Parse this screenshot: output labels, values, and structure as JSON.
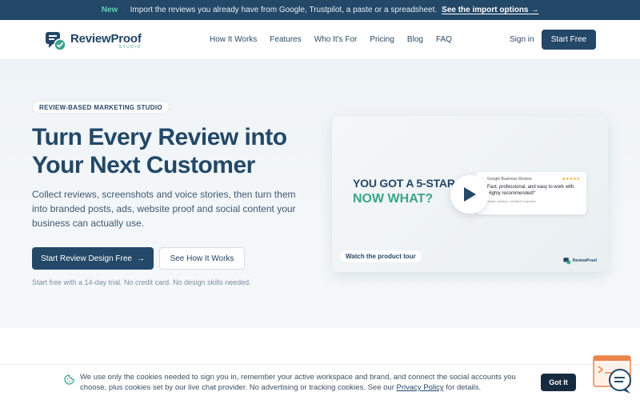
{
  "announcement": {
    "new_label": "New",
    "separator": "·",
    "text": "Import the reviews you already have from Google, Trustpilot, a paste or a spreadsheet.",
    "link": "See the import options",
    "link_arrow": "→"
  },
  "brand": {
    "name": "ReviewProof",
    "sub": "STUDIO"
  },
  "nav": {
    "items": [
      {
        "label": "How It Works"
      },
      {
        "label": "Features"
      },
      {
        "label": "Who It's For"
      },
      {
        "label": "Pricing"
      },
      {
        "label": "Blog"
      },
      {
        "label": "FAQ"
      }
    ],
    "signin": "Sign in",
    "start_free": "Start Free"
  },
  "hero": {
    "badge": "REVIEW-BASED MARKETING STUDIO",
    "headline": "Turn Every Review into Your Next Customer",
    "lede": "Collect reviews, screenshots and voice stories, then turn them into branded posts, ads, website proof and social content your business can actually use.",
    "cta_primary": "Start Review Design Free",
    "cta_primary_arrow": "→",
    "cta_secondary": "See How It Works",
    "fineprint": "Start free with a 14-day trial. No credit card. No design skills needed."
  },
  "video": {
    "line1": "YOU GOT A 5-STAR REVIEW.",
    "line2": "NOW WHAT?",
    "review_source": "Google Business Review",
    "review_stars": "★★★★★",
    "review_body": "Fast, professional, and easy to work with. Highly recommended!\"",
    "review_author": "Sarah Jenkins • Verified Customer",
    "tour_label": "Watch the product tour",
    "brand": "ReviewProof"
  },
  "cookie": {
    "text_before": "We use only the cookies needed to sign you in, remember your active workspace and brand, and connect the social accounts you choose, plus cookies set by our live chat provider. No advertising or tracking cookies. See our ",
    "policy_link": "Privacy Policy",
    "text_after": " for details.",
    "accept": "Got It"
  },
  "colors": {
    "primary": "#234868",
    "accent": "#3aa58a",
    "announcement_bg": "#234868",
    "hero_bg": "#eef3f7"
  },
  "icons": [
    "brand-logo-icon",
    "play-icon",
    "arrow-right-icon",
    "cookie-icon",
    "chat-support-icon"
  ]
}
